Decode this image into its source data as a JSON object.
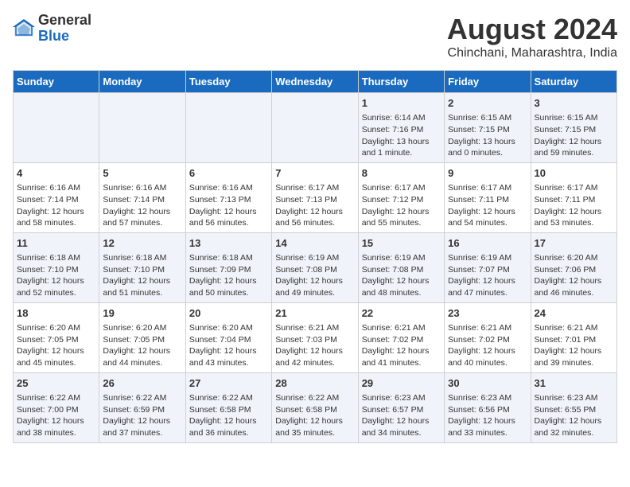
{
  "logo": {
    "general": "General",
    "blue": "Blue"
  },
  "title": "August 2024",
  "subtitle": "Chinchani, Maharashtra, India",
  "days_of_week": [
    "Sunday",
    "Monday",
    "Tuesday",
    "Wednesday",
    "Thursday",
    "Friday",
    "Saturday"
  ],
  "weeks": [
    [
      {
        "day": "",
        "content": ""
      },
      {
        "day": "",
        "content": ""
      },
      {
        "day": "",
        "content": ""
      },
      {
        "day": "",
        "content": ""
      },
      {
        "day": "1",
        "content": "Sunrise: 6:14 AM\nSunset: 7:16 PM\nDaylight: 13 hours\nand 1 minute."
      },
      {
        "day": "2",
        "content": "Sunrise: 6:15 AM\nSunset: 7:15 PM\nDaylight: 13 hours\nand 0 minutes."
      },
      {
        "day": "3",
        "content": "Sunrise: 6:15 AM\nSunset: 7:15 PM\nDaylight: 12 hours\nand 59 minutes."
      }
    ],
    [
      {
        "day": "4",
        "content": "Sunrise: 6:16 AM\nSunset: 7:14 PM\nDaylight: 12 hours\nand 58 minutes."
      },
      {
        "day": "5",
        "content": "Sunrise: 6:16 AM\nSunset: 7:14 PM\nDaylight: 12 hours\nand 57 minutes."
      },
      {
        "day": "6",
        "content": "Sunrise: 6:16 AM\nSunset: 7:13 PM\nDaylight: 12 hours\nand 56 minutes."
      },
      {
        "day": "7",
        "content": "Sunrise: 6:17 AM\nSunset: 7:13 PM\nDaylight: 12 hours\nand 56 minutes."
      },
      {
        "day": "8",
        "content": "Sunrise: 6:17 AM\nSunset: 7:12 PM\nDaylight: 12 hours\nand 55 minutes."
      },
      {
        "day": "9",
        "content": "Sunrise: 6:17 AM\nSunset: 7:11 PM\nDaylight: 12 hours\nand 54 minutes."
      },
      {
        "day": "10",
        "content": "Sunrise: 6:17 AM\nSunset: 7:11 PM\nDaylight: 12 hours\nand 53 minutes."
      }
    ],
    [
      {
        "day": "11",
        "content": "Sunrise: 6:18 AM\nSunset: 7:10 PM\nDaylight: 12 hours\nand 52 minutes."
      },
      {
        "day": "12",
        "content": "Sunrise: 6:18 AM\nSunset: 7:10 PM\nDaylight: 12 hours\nand 51 minutes."
      },
      {
        "day": "13",
        "content": "Sunrise: 6:18 AM\nSunset: 7:09 PM\nDaylight: 12 hours\nand 50 minutes."
      },
      {
        "day": "14",
        "content": "Sunrise: 6:19 AM\nSunset: 7:08 PM\nDaylight: 12 hours\nand 49 minutes."
      },
      {
        "day": "15",
        "content": "Sunrise: 6:19 AM\nSunset: 7:08 PM\nDaylight: 12 hours\nand 48 minutes."
      },
      {
        "day": "16",
        "content": "Sunrise: 6:19 AM\nSunset: 7:07 PM\nDaylight: 12 hours\nand 47 minutes."
      },
      {
        "day": "17",
        "content": "Sunrise: 6:20 AM\nSunset: 7:06 PM\nDaylight: 12 hours\nand 46 minutes."
      }
    ],
    [
      {
        "day": "18",
        "content": "Sunrise: 6:20 AM\nSunset: 7:05 PM\nDaylight: 12 hours\nand 45 minutes."
      },
      {
        "day": "19",
        "content": "Sunrise: 6:20 AM\nSunset: 7:05 PM\nDaylight: 12 hours\nand 44 minutes."
      },
      {
        "day": "20",
        "content": "Sunrise: 6:20 AM\nSunset: 7:04 PM\nDaylight: 12 hours\nand 43 minutes."
      },
      {
        "day": "21",
        "content": "Sunrise: 6:21 AM\nSunset: 7:03 PM\nDaylight: 12 hours\nand 42 minutes."
      },
      {
        "day": "22",
        "content": "Sunrise: 6:21 AM\nSunset: 7:02 PM\nDaylight: 12 hours\nand 41 minutes."
      },
      {
        "day": "23",
        "content": "Sunrise: 6:21 AM\nSunset: 7:02 PM\nDaylight: 12 hours\nand 40 minutes."
      },
      {
        "day": "24",
        "content": "Sunrise: 6:21 AM\nSunset: 7:01 PM\nDaylight: 12 hours\nand 39 minutes."
      }
    ],
    [
      {
        "day": "25",
        "content": "Sunrise: 6:22 AM\nSunset: 7:00 PM\nDaylight: 12 hours\nand 38 minutes."
      },
      {
        "day": "26",
        "content": "Sunrise: 6:22 AM\nSunset: 6:59 PM\nDaylight: 12 hours\nand 37 minutes."
      },
      {
        "day": "27",
        "content": "Sunrise: 6:22 AM\nSunset: 6:58 PM\nDaylight: 12 hours\nand 36 minutes."
      },
      {
        "day": "28",
        "content": "Sunrise: 6:22 AM\nSunset: 6:58 PM\nDaylight: 12 hours\nand 35 minutes."
      },
      {
        "day": "29",
        "content": "Sunrise: 6:23 AM\nSunset: 6:57 PM\nDaylight: 12 hours\nand 34 minutes."
      },
      {
        "day": "30",
        "content": "Sunrise: 6:23 AM\nSunset: 6:56 PM\nDaylight: 12 hours\nand 33 minutes."
      },
      {
        "day": "31",
        "content": "Sunrise: 6:23 AM\nSunset: 6:55 PM\nDaylight: 12 hours\nand 32 minutes."
      }
    ]
  ]
}
